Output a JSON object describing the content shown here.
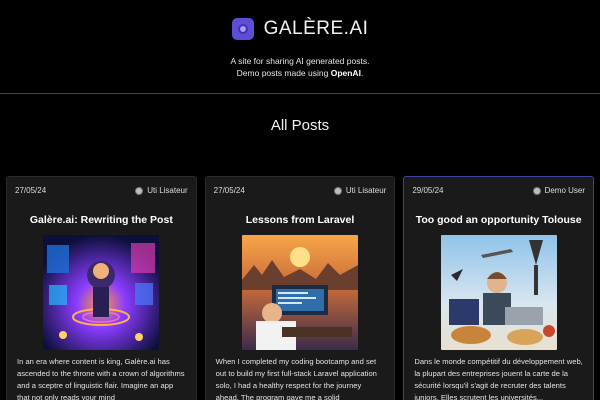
{
  "site": {
    "name": "GALÈRE.AI",
    "tagline_line1": "A site for sharing AI generated posts.",
    "tagline_prefix": "Demo posts made using ",
    "tagline_brand": "OpenAI",
    "tagline_suffix": "."
  },
  "section": {
    "title": "All Posts"
  },
  "posts": [
    {
      "date": "27/05/24",
      "author": "Uti Lisateur",
      "title": "Galère.ai: Rewriting the Post",
      "excerpt": "In an era where content is king, Galère.ai has ascended to the throne with a crown of algorithms and a sceptre of linguistic flair. Imagine an app that not only reads your mind"
    },
    {
      "date": "27/05/24",
      "author": "Uti Lisateur",
      "title": "Lessons from Laravel",
      "excerpt": "When I completed my coding bootcamp and set out to build my first full-stack Laravel application solo, I had a healthy respect for the journey ahead. The program gave me a solid"
    },
    {
      "date": "29/05/24",
      "author": "Demo User",
      "title": "Too good an opportunity Tolouse",
      "excerpt": "Dans le monde compétitif du développement web, la plupart des entreprises jouent la carte de la sécurité lorsqu'il s'agit de recruter des talents juniors. Elles scrutent les universités..."
    }
  ],
  "colors": {
    "accent": "#5c4fd6",
    "divider": "#3a3a8a",
    "card_bg": "#1a1a1a"
  }
}
